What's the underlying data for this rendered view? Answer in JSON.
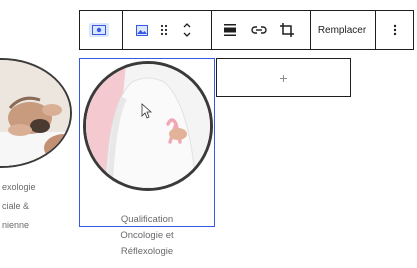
{
  "toolbar": {
    "block_type_icon": "image-block-icon",
    "image_icon": "image-icon",
    "drag_handle_icon": "drag-handle-icon",
    "move_icon": "chevron-up-down-icon",
    "align_icon": "align-icon",
    "link_icon": "link-icon",
    "crop_icon": "crop-icon",
    "replace_label": "Remplacer",
    "options_icon": "vertical-dots-icon"
  },
  "left_card": {
    "caption_lines": [
      "exologie",
      "ciale &",
      "nienne"
    ]
  },
  "selected_card": {
    "caption_lines": [
      "Qualification",
      "Oncologie et",
      "Réflexologie"
    ]
  },
  "appender": {
    "label": "+"
  },
  "colors": {
    "selection_outline": "#3858e9",
    "toolbar_border": "#1e1e1e",
    "caption_text": "#6a6a6a",
    "image_border": "#3a3a3a",
    "ribbon_pink": "#f2a7b4"
  }
}
